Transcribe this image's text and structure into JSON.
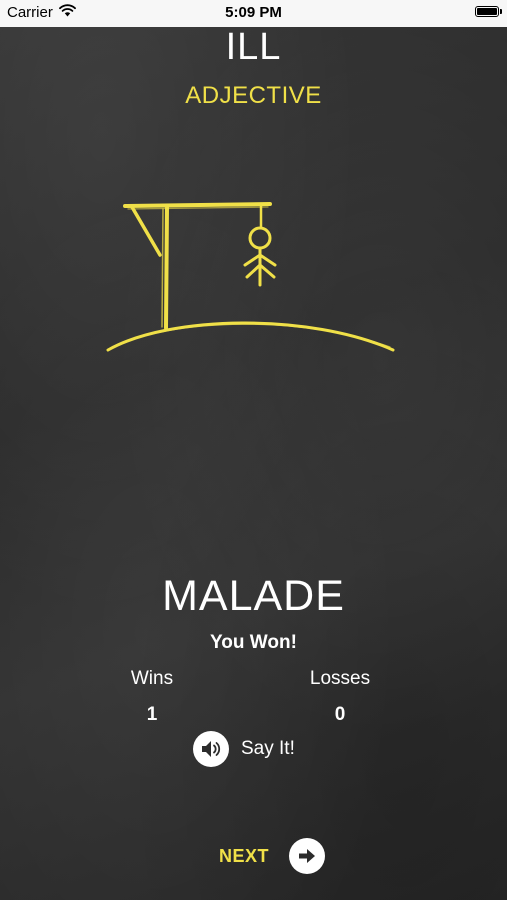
{
  "status_bar": {
    "carrier": "Carrier",
    "time": "5:09 PM",
    "wifi_icon": "wifi-icon",
    "battery_icon": "battery-icon"
  },
  "game": {
    "word": "ILL",
    "word_type": "ADJECTIVE",
    "answer": "MALADE",
    "result": "You Won!",
    "hangman_illustration": "gallows-with-head-arms-legs",
    "accent_color": "#f0e048"
  },
  "stats": {
    "wins_label": "Wins",
    "wins_value": "1",
    "losses_label": "Losses",
    "losses_value": "0"
  },
  "actions": {
    "say_it_label": "Say It!",
    "say_it_icon": "speaker-icon",
    "next_label": "NEXT",
    "next_icon": "arrow-right-icon"
  }
}
